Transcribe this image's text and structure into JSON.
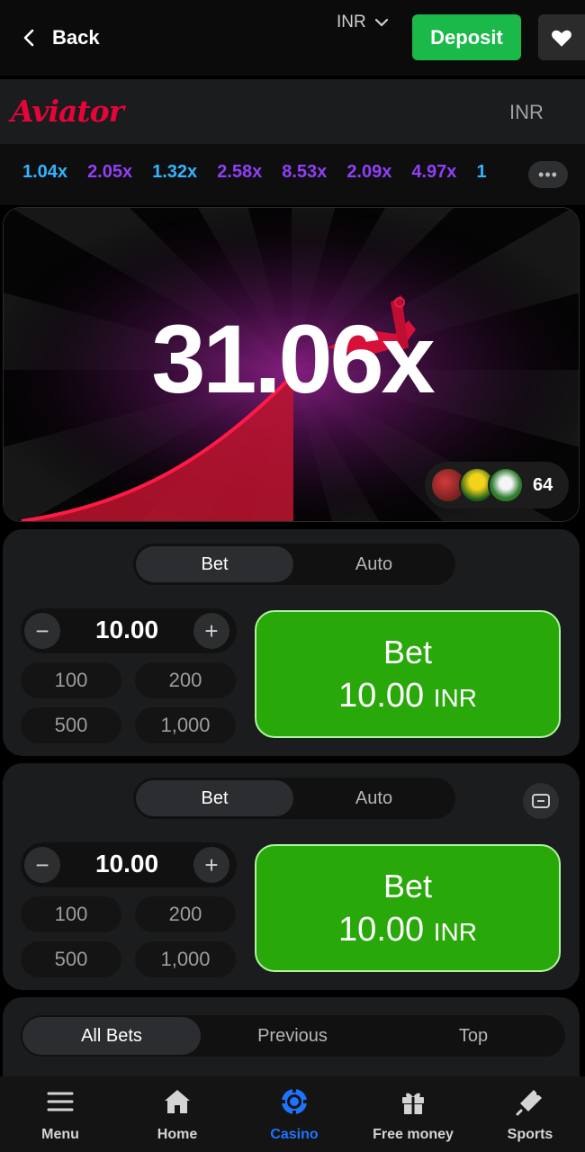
{
  "topbar": {
    "back_label": "Back",
    "currency": "INR",
    "deposit_label": "Deposit"
  },
  "game_header": {
    "logo_text": "Aviator",
    "currency": "INR"
  },
  "history": {
    "multipliers": [
      {
        "value": "1.04x",
        "color": "#34b4ff"
      },
      {
        "value": "2.05x",
        "color": "#913ef8"
      },
      {
        "value": "1.32x",
        "color": "#34b4ff"
      },
      {
        "value": "2.58x",
        "color": "#913ef8"
      },
      {
        "value": "8.53x",
        "color": "#913ef8"
      },
      {
        "value": "2.09x",
        "color": "#913ef8"
      },
      {
        "value": "4.97x",
        "color": "#913ef8"
      },
      {
        "value": "1",
        "color": "#34b4ff"
      }
    ],
    "more_label": "•••"
  },
  "game": {
    "multiplier": "31.06x",
    "player_count": "64"
  },
  "bet_panels": [
    {
      "tab_active": "Bet",
      "tab_inactive": "Auto",
      "amount": "10.00",
      "quick": [
        "100",
        "200",
        "500",
        "1,000"
      ],
      "button_label": "Bet",
      "button_amount": "10.00",
      "button_currency": "INR"
    },
    {
      "tab_active": "Bet",
      "tab_inactive": "Auto",
      "amount": "10.00",
      "quick": [
        "100",
        "200",
        "500",
        "1,000"
      ],
      "button_label": "Bet",
      "button_amount": "10.00",
      "button_currency": "INR"
    }
  ],
  "bets_tabs": [
    "All Bets",
    "Previous",
    "Top"
  ],
  "bottom_nav": [
    {
      "label": "Menu",
      "icon": "menu-icon"
    },
    {
      "label": "Home",
      "icon": "home-icon"
    },
    {
      "label": "Casino",
      "icon": "casino-chip-icon",
      "active": true
    },
    {
      "label": "Free money",
      "icon": "gift-icon"
    },
    {
      "label": "Sports",
      "icon": "sports-icon"
    }
  ],
  "colors": {
    "deposit_green": "#1bb84a",
    "bet_green": "#28a909",
    "brand_red": "#e50539",
    "active_blue": "#1e74ff"
  }
}
